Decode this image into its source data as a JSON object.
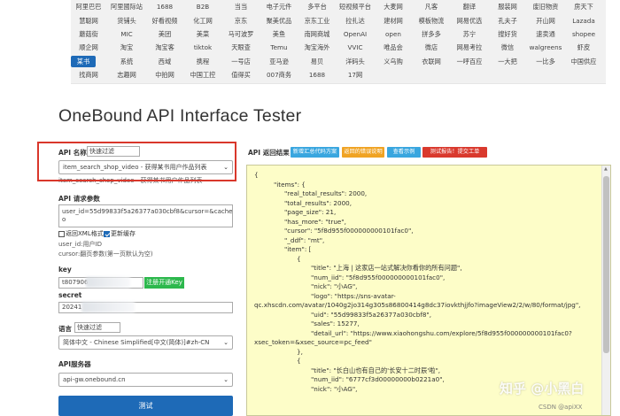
{
  "platforms": [
    [
      "阿里巴巴",
      "阿里國际站",
      "1688",
      "B2B",
      "当当",
      "电子元件",
      "多平台",
      "短视频平台",
      "大麦网",
      "凡客",
      "翻译",
      "服装网",
      "废旧物资",
      "房天下"
    ],
    [
      "慧聪网",
      "货铺头",
      "好看视频",
      "化工网",
      "京东",
      "聚美优品",
      "京东工业",
      "拉扎达",
      "建材网",
      "模板物流",
      "网易优选",
      "孔夫子",
      "开山网",
      "Lazada"
    ],
    [
      "蘑菇街",
      "MIC",
      "美团",
      "美菜",
      "马可波罗",
      "美鱼",
      "南网商城",
      "OpenAI",
      "open",
      "拼多多",
      "苏宁",
      "搜好货",
      "速卖通",
      "shopee"
    ],
    [
      "顺企网",
      "淘宝",
      "淘宝客",
      "tiktok",
      "天眼查",
      "Temu",
      "淘宝海外",
      "VVIC",
      "唯品会",
      "微店",
      "网易考拉",
      "微信",
      "walgreens",
      "虾皮"
    ],
    [
      "某书",
      "系统",
      "西域",
      "携程",
      "一号店",
      "亚马逊",
      "易贝",
      "洋码头",
      "义乌购",
      "衣联网",
      "一呼百应",
      "一大把",
      "一比多",
      "中国供应"
    ],
    [
      "找商网",
      "志趣网",
      "中拍网",
      "中国工控",
      "值得买",
      "007商务",
      "1688",
      "17网"
    ]
  ],
  "active_platform": "某书",
  "page_title": "OneBound API Interface Tester",
  "form": {
    "api_name_label": "API 名称",
    "filter_placeholder": "快速过滤",
    "api_selected": "item_search_shop_video - 获得某书用户作品列表",
    "api_desc": "item_search_shop_video - 获得某书用户作品列表",
    "params_label": "API 请求参数",
    "params_value": "user_id=55d99833f5a26377a030cbf8&cursor=&cache=n",
    "params_value_line2": "o",
    "opt_xml": "返回XML格式",
    "opt_cache": "更新缓存",
    "hint_user": "user_id:用户ID",
    "hint_cursor": "cursor:翻页参数(第一页默认为空)",
    "key_label": "key",
    "key_value": "t807906",
    "register_btn": "注册开通Key",
    "secret_label": "secret",
    "secret_value": "20241",
    "lang_label": "语言",
    "lang_filter": "快速过滤",
    "lang_value": "简体中文 - Chinese Simplified[中文(简体)]#zh-CN",
    "server_label": "API服务器",
    "server_value": "api-gw.onebound.cn",
    "test_btn": "测试"
  },
  "result": {
    "label": "API 返回结果",
    "btn_new": "新增汇总代码方案",
    "btn_err": "返回的错误说明",
    "btn_example": "查看示例",
    "btn_feedback": "测试报告！提交工单",
    "lines": [
      "{",
      "\"items\": {",
      "\"real_total_results\": 2000,",
      "\"total_results\": 2000,",
      "\"page_size\": 21,",
      "\"has_more\": \"true\",",
      "\"cursor\": \"5f8d955f000000000101fac0\",",
      "\"_ddf\": \"mt\",",
      "\"item\": [",
      "{",
      "\"title\": \"上海 | 这家店一站式解决你看你的所有问题\",",
      "\"num_iid\": \"5f8d955f000000000101fac0\",",
      "\"nick\": \"小AG\",",
      "\"logo\": \"https://sns-avatar-",
      "qc.xhscdn.com/avatar/1040g2jo314g305s86800414g8dc37iovkthjjfo?imageView2/2/w/80/format/jpg\",",
      "\"uid\": \"55d99833f5a26377a030cbf8\",",
      "\"sales\": 15277,",
      "\"detail_url\": \"https://www.xiaohongshu.com/explore/5f8d955f000000000101fac0?",
      "xsec_token=&xsec_source=pc_feed\"",
      "},",
      "{",
      "\"title\": \"长白山也有自己的'长安十二时辰'啦\",",
      "\"num_iid\": \"6777cf3d00000000b0221a0\",",
      "\"nick\": \"小AG\","
    ]
  },
  "watermark": "知乎 @小黑白",
  "csdn": "CSDN @apiXX"
}
